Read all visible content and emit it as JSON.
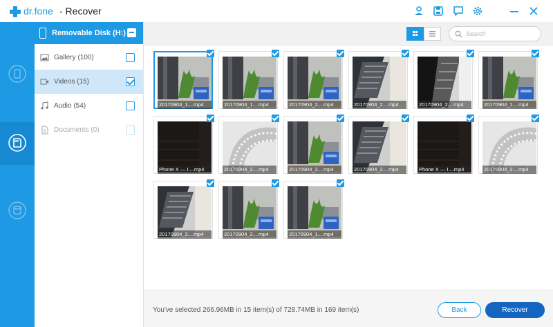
{
  "app": {
    "brand": "dr.fone",
    "title": "- Recover"
  },
  "titlebar_icons": [
    "user-icon",
    "save-icon",
    "feedback-icon",
    "settings-icon",
    "minimize-icon",
    "close-icon"
  ],
  "accent_color": "#1e9ae5",
  "sidebar": {
    "items": [
      {
        "icon": "phone-recover-icon",
        "active": false
      },
      {
        "icon": "sd-card-recover-icon",
        "active": true
      },
      {
        "icon": "device-restore-icon",
        "active": false
      }
    ]
  },
  "categories": {
    "header": "Removable Disk (H:)",
    "items": [
      {
        "label": "Gallery (100)",
        "icon": "image-icon",
        "checked": false,
        "selected": false,
        "disabled": false
      },
      {
        "label": "Videos (15)",
        "icon": "video-icon",
        "checked": true,
        "selected": true,
        "disabled": false
      },
      {
        "label": "Audio (54)",
        "icon": "music-icon",
        "checked": false,
        "selected": false,
        "disabled": false
      },
      {
        "label": "Documents (0)",
        "icon": "document-icon",
        "checked": false,
        "selected": false,
        "disabled": true
      }
    ]
  },
  "toolbar": {
    "search_placeholder": "Search",
    "view_mode": "grid"
  },
  "thumbnails": [
    {
      "caption": "20170904_1....mp4",
      "scene": "plant",
      "checked": true
    },
    {
      "caption": "20170904_1....mp4",
      "scene": "plant",
      "checked": true
    },
    {
      "caption": "20170904_2....mp4",
      "scene": "plant",
      "checked": true
    },
    {
      "caption": "20170904_2....mp4",
      "scene": "desk",
      "checked": true
    },
    {
      "caption": "20170904_2....mp4",
      "scene": "kb",
      "checked": true
    },
    {
      "caption": "20170904_1....mp4",
      "scene": "plant",
      "checked": true
    },
    {
      "caption": "Phone X — I....mp4",
      "scene": "dark",
      "checked": true
    },
    {
      "caption": "20170904_2....mp4",
      "scene": "film",
      "checked": true
    },
    {
      "caption": "20170904_2....mp4",
      "scene": "plant",
      "checked": true
    },
    {
      "caption": "20170904_2....mp4",
      "scene": "desk",
      "checked": true
    },
    {
      "caption": "Phone X — I....mp4",
      "scene": "dark",
      "checked": true
    },
    {
      "caption": "20170904_2....mp4",
      "scene": "film",
      "checked": true
    },
    {
      "caption": "20170904_2....mp4",
      "scene": "desk",
      "checked": true
    },
    {
      "caption": "20170904_2....mp4",
      "scene": "plant",
      "checked": true
    },
    {
      "caption": "20170904_1....mp4",
      "scene": "plant",
      "checked": true
    }
  ],
  "footer": {
    "status": "You've selected 266.96MB in 15 item(s) of 728.74MB in 169 item(s)",
    "back_label": "Back",
    "recover_label": "Recover"
  }
}
